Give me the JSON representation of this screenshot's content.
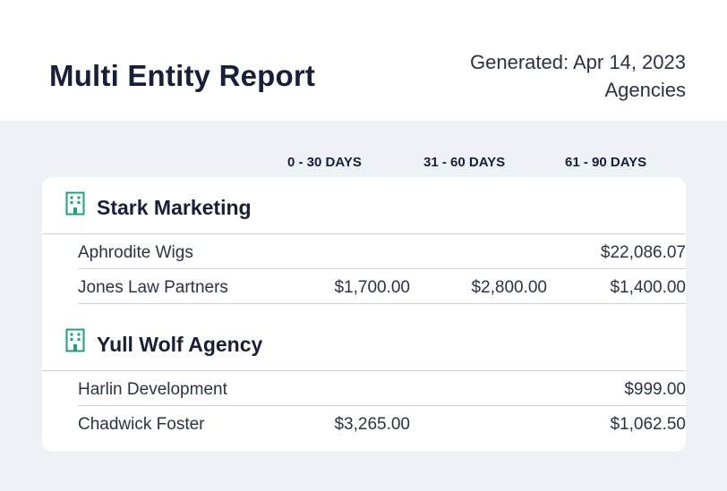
{
  "report": {
    "title": "Multi Entity Report",
    "generated": "Generated: Apr 14, 2023",
    "scope": "Agencies"
  },
  "columns": [
    "0 - 30 DAYS",
    "31 - 60 DAYS",
    "61 - 90 DAYS"
  ],
  "groups": [
    {
      "name": "Stark Marketing",
      "icon": "building-icon",
      "rows": [
        {
          "name": "Aphrodite Wigs",
          "d0_30": "",
          "d31_60": "",
          "d61_90": "$22,086.07"
        },
        {
          "name": "Jones Law Partners",
          "d0_30": "$1,700.00",
          "d31_60": "$2,800.00",
          "d61_90": "$1,400.00"
        }
      ]
    },
    {
      "name": "Yull Wolf Agency",
      "icon": "building-icon",
      "rows": [
        {
          "name": "Harlin Development",
          "d0_30": "",
          "d31_60": "",
          "d61_90": "$999.00"
        },
        {
          "name": "Chadwick Foster",
          "d0_30": "$3,265.00",
          "d31_60": "",
          "d61_90": "$1,062.50"
        }
      ]
    }
  ],
  "colors": {
    "accent": "#1aa37a",
    "panel": "#eef1f6",
    "divider": "#c9d1dc"
  }
}
